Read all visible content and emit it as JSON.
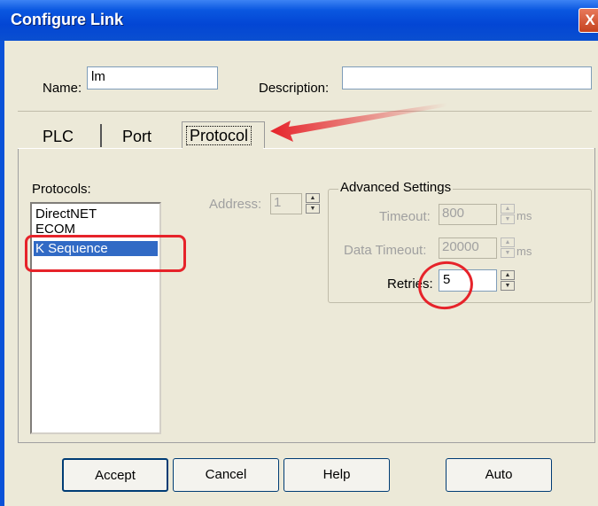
{
  "window": {
    "title": "Configure Link",
    "close_glyph": "X"
  },
  "name_label": "Name:",
  "name_value": "lm",
  "description_label": "Description:",
  "description_value": "",
  "tabs": [
    {
      "label": "PLC"
    },
    {
      "label": "Port"
    },
    {
      "label": "Protocol",
      "active": true
    }
  ],
  "protocols_label": "Protocols:",
  "protocols": [
    "DirectNET",
    "ECOM",
    "K Sequence"
  ],
  "selected_protocol": "K Sequence",
  "address_label": "Address:",
  "address_value": "1",
  "advanced": {
    "title": "Advanced Settings",
    "timeout_label": "Timeout:",
    "timeout_value": "800",
    "timeout_unit": "ms",
    "data_timeout_label": "Data Timeout:",
    "data_timeout_value": "20000",
    "data_timeout_unit": "ms",
    "retries_label": "Retries:",
    "retries_value": "5"
  },
  "buttons": {
    "accept": "Accept",
    "cancel": "Cancel",
    "help": "Help",
    "auto": "Auto"
  },
  "colors": {
    "annotation_red": "#e6232a",
    "selection": "#316ac5",
    "titlebar": "#0a4fd0"
  }
}
